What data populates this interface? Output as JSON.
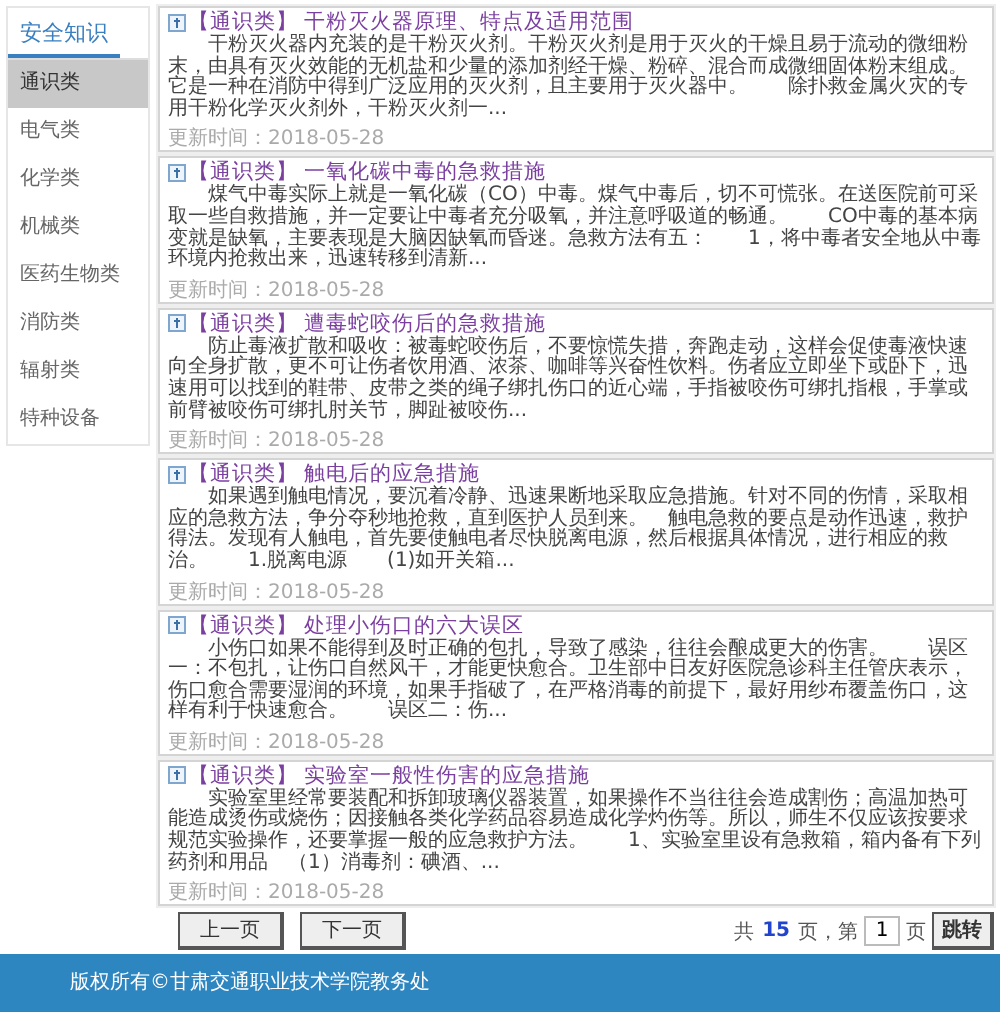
{
  "sidebar": {
    "title": "安全知识",
    "items": [
      {
        "label": "通识类",
        "selected": true
      },
      {
        "label": "电气类",
        "selected": false
      },
      {
        "label": "化学类",
        "selected": false
      },
      {
        "label": "机械类",
        "selected": false
      },
      {
        "label": "医药生物类",
        "selected": false
      },
      {
        "label": "消防类",
        "selected": false
      },
      {
        "label": "辐射类",
        "selected": false
      },
      {
        "label": "特种设备",
        "selected": false
      }
    ]
  },
  "articles": [
    {
      "category": "【通识类】",
      "title": "干粉灭火器原理、特点及适用范围",
      "excerpt": "干粉灭火器内充装的是干粉灭火剂。干粉灭火剂是用于灭火的干燥且易于流动的微细粉末，由具有灭火效能的无机盐和少量的添加剂经干燥、粉碎、混合而成微细固体粉末组成。它是一种在消防中得到广泛应用的灭火剂，且主要用于灭火器中。　　除扑救金属火灾的专用干粉化学灭火剂外，干粉灭火剂一...",
      "date": "更新时间：2018-05-28"
    },
    {
      "category": "【通识类】",
      "title": "一氧化碳中毒的急救措施",
      "excerpt": "煤气中毒实际上就是一氧化碳（CO）中毒。煤气中毒后，切不可慌张。在送医院前可采取一些自救措施，并一定要让中毒者充分吸氧，并注意呼吸道的畅通。　　CO中毒的基本病变就是缺氧，主要表现是大脑因缺氧而昏迷。急救方法有五：　　1，将中毒者安全地从中毒环境内抢救出来，迅速转移到清新...",
      "date": "更新时间：2018-05-28"
    },
    {
      "category": "【通识类】",
      "title": "遭毒蛇咬伤后的急救措施",
      "excerpt": "防止毒液扩散和吸收：被毒蛇咬伤后，不要惊慌失措，奔跑走动，这样会促使毒液快速向全身扩散，更不可让伤者饮用酒、浓茶、咖啡等兴奋性饮料。伤者应立即坐下或卧下，迅速用可以找到的鞋带、皮带之类的绳子绑扎伤口的近心端，手指被咬伤可绑扎指根，手掌或前臂被咬伤可绑扎肘关节，脚趾被咬伤...",
      "date": "更新时间：2018-05-28"
    },
    {
      "category": "【通识类】",
      "title": "触电后的应急措施",
      "excerpt": "如果遇到触电情况，要沉着冷静、迅速果断地采取应急措施。针对不同的伤情，采取相应的急救方法，争分夺秒地抢救，直到医护人员到来。　触电急救的要点是动作迅速，救护得法。发现有人触电，首先要使触电者尽快脱离电源，然后根据具体情况，进行相应的救治。　　1.脱离电源　　(1)如开关箱...",
      "date": "更新时间：2018-05-28"
    },
    {
      "category": "【通识类】",
      "title": "处理小伤口的六大误区",
      "excerpt": "小伤口如果不能得到及时正确的包扎，导致了感染，往往会酿成更大的伤害。　　误区一：不包扎，让伤口自然风干，才能更快愈合。卫生部中日友好医院急诊科主任管庆表示，伤口愈合需要湿润的环境，如果手指破了，在严格消毒的前提下，最好用纱布覆盖伤口，这样有利于快速愈合。　　误区二：伤...",
      "date": "更新时间：2018-05-28"
    },
    {
      "category": "【通识类】",
      "title": "实验室一般性伤害的应急措施",
      "excerpt": "实验室里经常要装配和拆卸玻璃仪器装置，如果操作不当往往会造成割伤；高温加热可能造成烫伤或烧伤；因接触各类化学药品容易造成化学灼伤等。所以，师生不仅应该按要求规范实验操作，还要掌握一般的应急救护方法。　　1、实验室里设有急救箱，箱内备有下列药剂和用品　（1）消毒剂：碘酒、...",
      "date": "更新时间：2018-05-28"
    }
  ],
  "pagination": {
    "prev": "上一页",
    "next": "下一页",
    "total_prefix": "共",
    "total_pages": "15",
    "total_suffix": "页，第",
    "page": "1",
    "page_suffix": "页",
    "go": "跳转"
  },
  "footer": {
    "copyright": "版权所有©甘肃交通职业技术学院教务处"
  }
}
